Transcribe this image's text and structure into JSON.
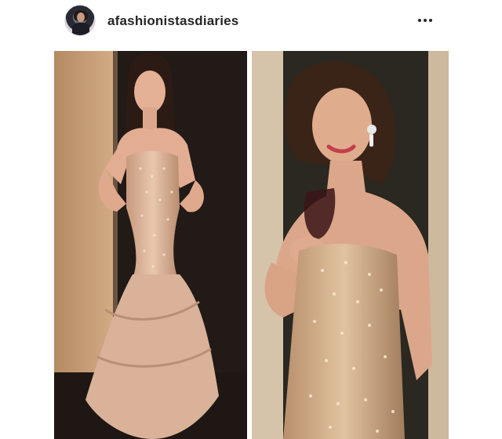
{
  "post": {
    "username": "afashionistasdiaries"
  },
  "icons": {
    "avatar": "profile-avatar",
    "more": "more-options-icon"
  },
  "colors": {
    "username": "#262626",
    "background": "#ffffff"
  }
}
